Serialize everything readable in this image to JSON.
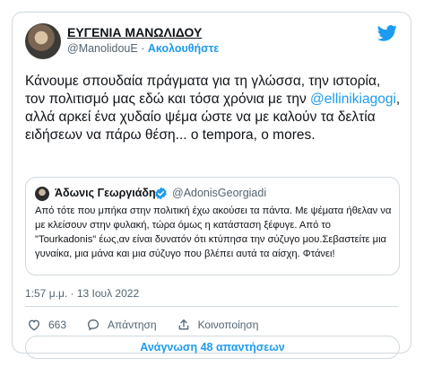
{
  "author": {
    "name": "ΕΥΓΕΝΙΑ ΜΑΝΩΛΙΔΟΥ",
    "handle": "@ManolidouE",
    "separator": "·",
    "follow_label": "Ακολουθήστε"
  },
  "tweet": {
    "text_part1": "Κάνουμε σπουδαία πράγματα για τη γλώσσα, την ιστορία, τον πολιτισμό μας εδώ και τόσα χρόνια με την ",
    "mention": "@ellinikiagogi",
    "text_part2": ", αλλά αρκεί ένα χυδαίο ψέμα ώστε να με καλούν τα δελτία ειδήσεων να πάρω θέση... o tempora, o mores."
  },
  "quoted": {
    "name": "Άδωνις Γεωργιάδης",
    "handle": "@AdonisGeorgiadi",
    "text": "Από τότε που μπήκα στην πολιτική έχω ακούσει τα πάντα. Με ψέματα ήθελαν να με κλείσουν στην φυλακή, τώρα όμως η κατάσταση ξέφυγε. Από το \"Tourkadonis\" έως,αν είναι δυνατόν ότι κτύπησα την σύζυγο μου.Σεβαστείτε μια γυναίκα, μια μάνα και μια σύζυγο που βλέπει αυτά τα αίσχη. Φτάνει!"
  },
  "timestamp": "1:57 μ.μ. · 13 Ιουλ 2022",
  "actions": {
    "like_count": "663",
    "reply_label": "Απάντηση",
    "share_label": "Κοινοποίηση"
  },
  "read_replies_label": "Ανάγνωση 48 απαντήσεων",
  "colors": {
    "accent": "#1d9bf0",
    "text": "#0f1419",
    "muted": "#536471",
    "border": "#cfd9de"
  }
}
